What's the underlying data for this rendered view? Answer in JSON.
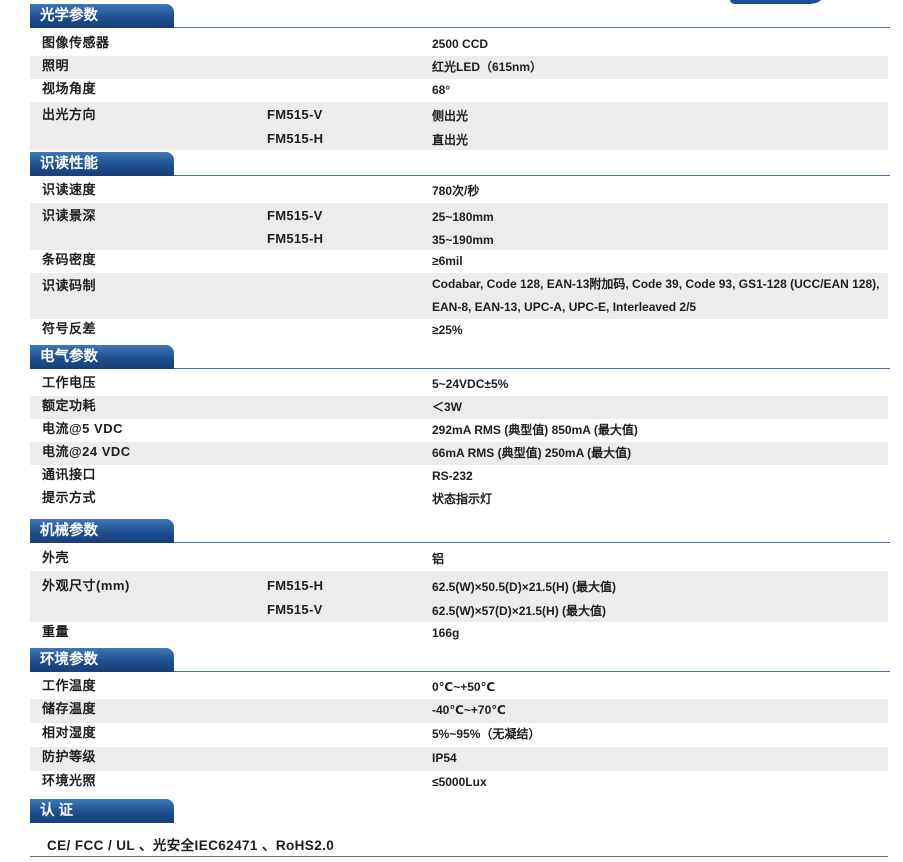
{
  "sections": [
    {
      "title": "光学参数",
      "rows": [
        {
          "label": "图像传感器",
          "models": [
            ""
          ],
          "values": [
            "2500 CCD"
          ]
        },
        {
          "label": "照明",
          "models": [
            ""
          ],
          "values": [
            "红光LED（615nm）"
          ]
        },
        {
          "label": "视场角度",
          "models": [
            ""
          ],
          "values": [
            "68°"
          ]
        },
        {
          "label": "出光方向",
          "models": [
            "FM515-V",
            "FM515-H"
          ],
          "values": [
            "侧出光",
            "直出光"
          ]
        }
      ]
    },
    {
      "title": "识读性能",
      "rows": [
        {
          "label": "识读速度",
          "models": [
            ""
          ],
          "values": [
            "780次/秒"
          ]
        },
        {
          "label": "识读景深",
          "models": [
            "FM515-V",
            "FM515-H"
          ],
          "values": [
            "25~180mm",
            "35~190mm"
          ]
        },
        {
          "label": "条码密度",
          "models": [
            ""
          ],
          "values": [
            "≥6mil"
          ]
        },
        {
          "label": "识读码制",
          "models": [
            ""
          ],
          "values": [
            "Codabar, Code 128, EAN-13附加码, Code 39, Code 93, GS1-128 (UCC/EAN 128), EAN-8, EAN-13, UPC-A, UPC-E, Interleaved 2/5"
          ]
        },
        {
          "label": "符号反差",
          "models": [
            ""
          ],
          "values": [
            "≥25%"
          ]
        }
      ]
    },
    {
      "title": "电气参数",
      "rows": [
        {
          "label": "工作电压",
          "models": [
            ""
          ],
          "values": [
            "5~24VDC±5%"
          ]
        },
        {
          "label": "额定功耗",
          "models": [
            ""
          ],
          "values": [
            "＜3W"
          ]
        },
        {
          "label": "电流@5 VDC",
          "models": [
            ""
          ],
          "values": [
            "292mA RMS (典型值)  850mA (最大值)"
          ]
        },
        {
          "label": "电流@24 VDC",
          "models": [
            ""
          ],
          "values": [
            "66mA RMS (典型值)  250mA (最大值)"
          ]
        },
        {
          "label": "通讯接口",
          "models": [
            ""
          ],
          "values": [
            "RS-232"
          ]
        },
        {
          "label": "提示方式",
          "models": [
            ""
          ],
          "values": [
            "状态指示灯"
          ]
        }
      ]
    },
    {
      "title": "机械参数",
      "rows": [
        {
          "label": "外壳",
          "models": [
            ""
          ],
          "values": [
            "铝"
          ]
        },
        {
          "label": "外观尺寸(mm)",
          "models": [
            "FM515-H",
            "FM515-V"
          ],
          "values": [
            "62.5(W)×50.5(D)×21.5(H) (最大值)",
            "62.5(W)×57(D)×21.5(H) (最大值)"
          ]
        },
        {
          "label": "重量",
          "models": [
            ""
          ],
          "values": [
            "166g"
          ]
        }
      ]
    },
    {
      "title": "环境参数",
      "rows": [
        {
          "label": "工作温度",
          "models": [
            ""
          ],
          "values": [
            "0℃~+50℃"
          ]
        },
        {
          "label": "储存温度",
          "models": [
            ""
          ],
          "values": [
            "-40℃~+70℃"
          ]
        },
        {
          "label": "相对湿度",
          "models": [
            ""
          ],
          "values": [
            "5%~95%（无凝结）"
          ]
        },
        {
          "label": "防护等级",
          "models": [
            ""
          ],
          "values": [
            "IP54"
          ]
        },
        {
          "label": "环境光照",
          "models": [
            ""
          ],
          "values": [
            "≤5000Lux"
          ]
        }
      ]
    }
  ],
  "certification": {
    "title": "认  证",
    "text": "CE/ FCC / UL 、光安全IEC62471 、RoHS2.0"
  }
}
